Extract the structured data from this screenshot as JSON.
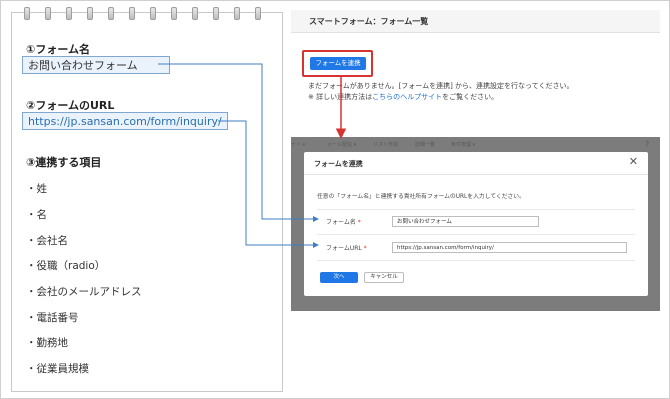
{
  "notebook": {
    "section1_label": "①フォーム名",
    "form_name_value": "お問い合わせフォーム",
    "section2_label": "②フォームのURL",
    "form_url_value": "https://jp.sansan.com/form/inquiry/",
    "section3_label": "③連携する項目",
    "items": [
      "・姓",
      "・名",
      "・会社名",
      "・役職（radio）",
      "・会社のメールアドレス",
      "・電話番号",
      "・勤務地",
      "・従業員規模"
    ]
  },
  "app": {
    "title": "スマートフォーム：フォーム一覧",
    "link_button": "フォームを連携",
    "message_line1": "まだフォームがありません。[フォームを連携] から、連携設定を行なってください。",
    "message_line2_prefix": "※ 詳しい連携方法は",
    "help_link": "こちらのヘルプサイト",
    "message_line2_suffix": "をご覧ください。"
  },
  "background_bar": {
    "items": [
      "ナト ▾",
      "メール配信 ▾",
      "リスト作成",
      "詳細一覧",
      "条件管理 ▾"
    ]
  },
  "modal": {
    "title": "フォームを連携",
    "close_symbol": "✕",
    "description": "任意の「フォーム名」と連携する貴社所有フォームのURLを入力してください。",
    "name_label": "フォーム名",
    "url_label": "フォームURL",
    "required_mark": "*",
    "name_value": "お問い合わせフォーム",
    "url_value": "https://jp.sansan.com/form/inquiry/",
    "next_button": "次へ",
    "cancel_button": "キャンセル"
  },
  "colors": {
    "accent_blue": "#1f78e6",
    "highlight_red": "#d83333",
    "connector_blue": "#3d7ec4"
  }
}
